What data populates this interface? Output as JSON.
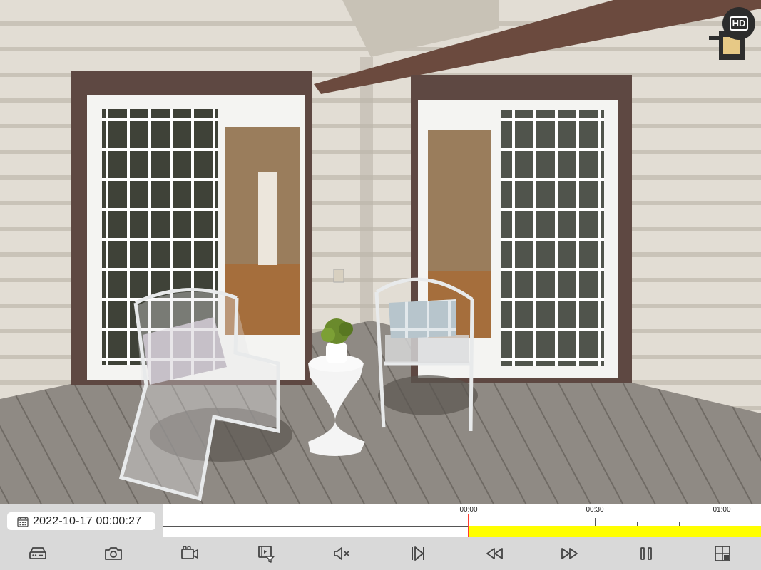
{
  "player": {
    "quality_badge": "HD",
    "timestamp": "2022-10-17 00:00:27"
  },
  "timeline": {
    "ticks": [
      {
        "label": "00:00"
      },
      {
        "label": "00:30"
      },
      {
        "label": "01:00"
      }
    ],
    "colors": {
      "recording": "#ffff00",
      "playhead": "#ff3b30"
    }
  },
  "toolbar": {
    "icons": [
      "nvr-device-icon",
      "snapshot-camera-icon",
      "record-video-icon",
      "clip-export-icon",
      "mute-icon",
      "next-frame-icon",
      "rewind-icon",
      "fast-forward-icon",
      "pause-icon",
      "layout-grid-icon"
    ]
  }
}
